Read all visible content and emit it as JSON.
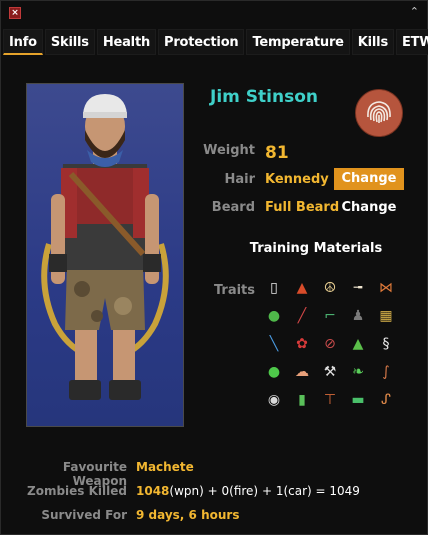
{
  "window": {
    "close_label": "×",
    "collapse_label": "⌃"
  },
  "tabs": [
    {
      "label": "Info",
      "active": true
    },
    {
      "label": "Skills"
    },
    {
      "label": "Health"
    },
    {
      "label": "Protection"
    },
    {
      "label": "Temperature"
    },
    {
      "label": "Kills"
    },
    {
      "label": "ETW"
    }
  ],
  "character": {
    "name": "Jim Stinson",
    "weight_label": "Weight",
    "weight": "81",
    "hair_label": "Hair",
    "hair": "Kennedy",
    "beard_label": "Beard",
    "beard": "Full Beard",
    "change_label": "Change"
  },
  "training_label": "Training Materials",
  "traits_label": "Traits",
  "trait_icons": [
    {
      "name": "trait-bed-icon",
      "glyph": "▯",
      "color": "#e8e8e8"
    },
    {
      "name": "trait-fire-icon",
      "glyph": "▲",
      "color": "#d84c2a"
    },
    {
      "name": "trait-peace-icon",
      "glyph": "☮",
      "color": "#e9cf92"
    },
    {
      "name": "trait-cigarette-icon",
      "glyph": "╼",
      "color": "#f0e6d0"
    },
    {
      "name": "trait-bow-icon",
      "glyph": "⋈",
      "color": "#e07a3a"
    },
    {
      "name": "trait-stomach-icon",
      "glyph": "●",
      "color": "#4fb84a"
    },
    {
      "name": "trait-needle-icon",
      "glyph": "╱",
      "color": "#d04646"
    },
    {
      "name": "trait-fishing-icon",
      "glyph": "⌐",
      "color": "#4ab070"
    },
    {
      "name": "trait-ghost-icon",
      "glyph": "♟",
      "color": "#7a7a7a"
    },
    {
      "name": "trait-map-icon",
      "glyph": "▦",
      "color": "#d8b24a"
    },
    {
      "name": "trait-wrench-icon",
      "glyph": "╲",
      "color": "#4a9ae0"
    },
    {
      "name": "trait-rose-icon",
      "glyph": "✿",
      "color": "#d83a3a"
    },
    {
      "name": "trait-no-tools-icon",
      "glyph": "⊘",
      "color": "#c94b4b"
    },
    {
      "name": "trait-camp-icon",
      "glyph": "▲",
      "color": "#5bbf4a"
    },
    {
      "name": "trait-swan-icon",
      "glyph": "§",
      "color": "#e8e8e8"
    },
    {
      "name": "trait-apple-icon",
      "glyph": "●",
      "color": "#4ec84a"
    },
    {
      "name": "trait-brain-icon",
      "glyph": "☁",
      "color": "#e8a07a"
    },
    {
      "name": "trait-hammer-icon",
      "glyph": "⚒",
      "color": "#e0e0e0"
    },
    {
      "name": "trait-leaf-icon",
      "glyph": "❧",
      "color": "#5bd05b"
    },
    {
      "name": "trait-ear-icon",
      "glyph": "∫",
      "color": "#d87a4a"
    },
    {
      "name": "trait-tape-icon",
      "glyph": "◉",
      "color": "#d8d8d8"
    },
    {
      "name": "trait-book-icon",
      "glyph": "▮",
      "color": "#5ac05a"
    },
    {
      "name": "trait-axe-icon",
      "glyph": "⊤",
      "color": "#d86a3a"
    },
    {
      "name": "trait-money-icon",
      "glyph": "▬",
      "color": "#4ac06a"
    },
    {
      "name": "trait-strong-icon",
      "glyph": "ᔑ",
      "color": "#e08a4a"
    }
  ],
  "stats": {
    "fav_weapon_label": "Favourite Weapon",
    "fav_weapon": "Machete",
    "zombies_label": "Zombies Killed",
    "zombies_wpn": "1048",
    "zombies_wpn_tag": "(wpn)",
    "plus1": " + ",
    "zombies_fire": "0",
    "zombies_fire_tag": "(fire)",
    "plus2": " + ",
    "zombies_car": "1",
    "zombies_car_tag": "(car)",
    "equals": " = ",
    "zombies_total": "1049",
    "survived_label": "Survived For",
    "survived": "9 days, 6 hours"
  },
  "colors": {
    "accent": "#e1931d",
    "name": "#3fd0c9",
    "value": "#f2b731",
    "label": "#8a8a8a"
  }
}
